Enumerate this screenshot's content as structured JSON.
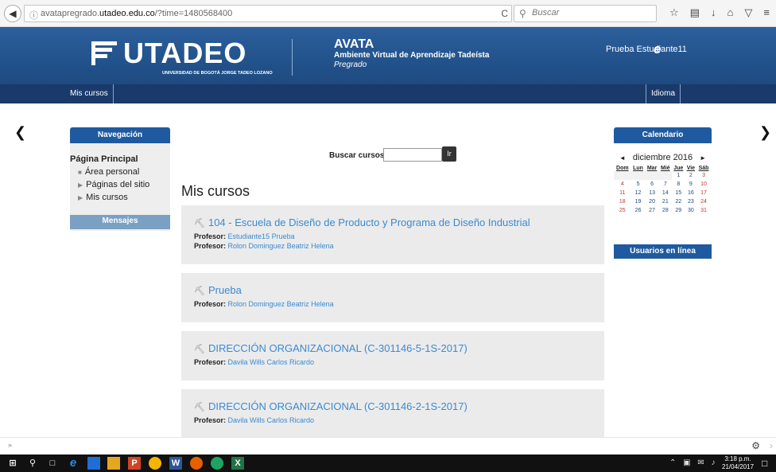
{
  "browser": {
    "info_glyph": "ⓘ",
    "url_host": "avatapregrado.",
    "url_domain": "utadeo.edu.co",
    "url_path": "/?time=1480568400",
    "search_placeholder": "Buscar",
    "search_glyph": "🔍",
    "reload_glyph": "C"
  },
  "header": {
    "logo_text": "UTADEO",
    "logo_subtitle": "UNIVERSIDAD DE BOGOTÁ JORGE TADEO LOZANO",
    "brand_title": "AVATA",
    "brand_subtitle": "Ambiente Virtual de Aprendizaje Tadeísta",
    "brand_level": "Pregrado",
    "user_name": "Prueba Estudiante11",
    "user_icon_glyph": "e"
  },
  "navbar": {
    "mis_cursos": "Mis cursos",
    "idioma": "Idioma"
  },
  "navigation": {
    "title": "Navegación",
    "home": "Página Principal",
    "items": [
      {
        "bullet": "■",
        "label": "Área personal"
      },
      {
        "bullet": "▶",
        "label": "Páginas del sitio"
      },
      {
        "bullet": "▶",
        "label": "Mis cursos"
      }
    ],
    "messages": "Mensajes"
  },
  "search": {
    "label": "Buscar cursos:",
    "button": "Ir"
  },
  "main": {
    "title": "Mis cursos",
    "courses": [
      {
        "title": "104 - Escuela de Diseño de Producto y Programa de Diseño Industrial",
        "teachers": [
          {
            "role": "Profesor:",
            "name": "Estudiante15 Prueba"
          },
          {
            "role": "Profesor:",
            "name": "Rolon Dominguez Beatriz Helena"
          }
        ]
      },
      {
        "title": "Prueba",
        "teachers": [
          {
            "role": "Profesor:",
            "name": "Rolon Dominguez Beatriz Helena"
          }
        ]
      },
      {
        "title": "DIRECCIÓN ORGANIZACIONAL (C-301146-5-1S-2017)",
        "teachers": [
          {
            "role": "Profesor:",
            "name": "Davila Wills Carlos Ricardo"
          }
        ]
      },
      {
        "title": "DIRECCIÓN ORGANIZACIONAL (C-301146-2-1S-2017)",
        "teachers": [
          {
            "role": "Profesor:",
            "name": "Davila Wills Carlos Ricardo"
          }
        ]
      }
    ]
  },
  "calendar": {
    "title": "Calendario",
    "month": "diciembre 2016",
    "prev": "◄",
    "next": "►",
    "days": [
      "Dom",
      "Lun",
      "Mar",
      "Mié",
      "Jue",
      "Vie",
      "Sáb"
    ],
    "weeks": [
      [
        "",
        "",
        "",
        "",
        "1",
        "2",
        "3"
      ],
      [
        "4",
        "5",
        "6",
        "7",
        "8",
        "9",
        "10"
      ],
      [
        "11",
        "12",
        "13",
        "14",
        "15",
        "16",
        "17"
      ],
      [
        "18",
        "19",
        "20",
        "21",
        "22",
        "23",
        "24"
      ],
      [
        "25",
        "26",
        "27",
        "28",
        "29",
        "30",
        "31"
      ]
    ],
    "online_users": "Usuarios en línea"
  },
  "taskbar": {
    "time": "3:18 p.m.",
    "date": "21/04/2017"
  },
  "colors": {
    "brand_blue": "#1f5aa0",
    "link_blue": "#3a8ad3",
    "navbar": "#193a6a",
    "weekend_red": "#c0392b"
  }
}
